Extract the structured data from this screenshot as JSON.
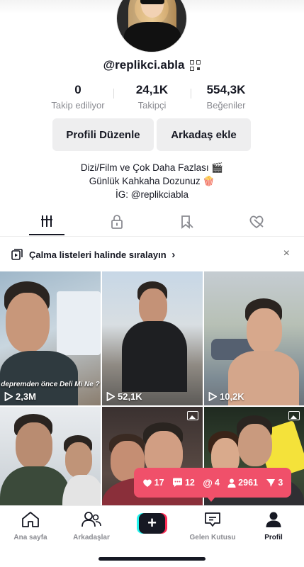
{
  "profile": {
    "username": "@replikci.abla"
  },
  "stats": [
    {
      "value": "0",
      "label": "Takip ediliyor"
    },
    {
      "value": "24,1K",
      "label": "Takipçi"
    },
    {
      "value": "554,3K",
      "label": "Beğeniler"
    }
  ],
  "buttons": {
    "edit_profile": "Profili Düzenle",
    "add_friend": "Arkadaş ekle"
  },
  "bio": {
    "line1": "Dizi/Film ve Çok Daha Fazlası 🎬",
    "line2": "Günlük Kahkaha Dozunuz 🍿",
    "line3": "İG: @replikciabla"
  },
  "tabs": [
    {
      "icon": "videos-grid-icon",
      "active": true
    },
    {
      "icon": "lock-icon",
      "active": false
    },
    {
      "icon": "bookmark-icon",
      "active": false
    },
    {
      "icon": "liked-heart-icon",
      "active": false
    }
  ],
  "playlist_banner": {
    "text": "Çalma listeleri halinde sıralayın",
    "chevron": "›",
    "close": "×"
  },
  "videos": [
    {
      "views": "2,3M",
      "caption": "depremden önce Deli Mi Ne ?",
      "type": "video"
    },
    {
      "views": "52,1K",
      "caption": "",
      "type": "video"
    },
    {
      "views": "10,2K",
      "caption": "",
      "type": "video"
    },
    {
      "views": "",
      "caption": "",
      "type": "video"
    },
    {
      "views": "",
      "caption": "",
      "type": "photo"
    },
    {
      "views": "",
      "caption": "",
      "type": "photo"
    }
  ],
  "notification": {
    "likes": "17",
    "comments": "12",
    "mentions": "4",
    "followers": "2961",
    "shares": "3"
  },
  "bottom_nav": [
    {
      "label": "Ana sayfa",
      "icon": "home-icon",
      "active": false
    },
    {
      "label": "Arkadaşlar",
      "icon": "friends-icon",
      "active": false
    },
    {
      "label": "",
      "icon": "plus-icon",
      "active": false
    },
    {
      "label": "Gelen Kutusu",
      "icon": "inbox-icon",
      "active": false
    },
    {
      "label": "Profil",
      "icon": "profile-icon",
      "active": true
    }
  ],
  "colors": {
    "accent_red": "#fe2c55",
    "accent_cyan": "#25f4ee",
    "notification_bg": "#f0506a",
    "text_primary": "#161823",
    "text_secondary": "#8a8b91"
  }
}
